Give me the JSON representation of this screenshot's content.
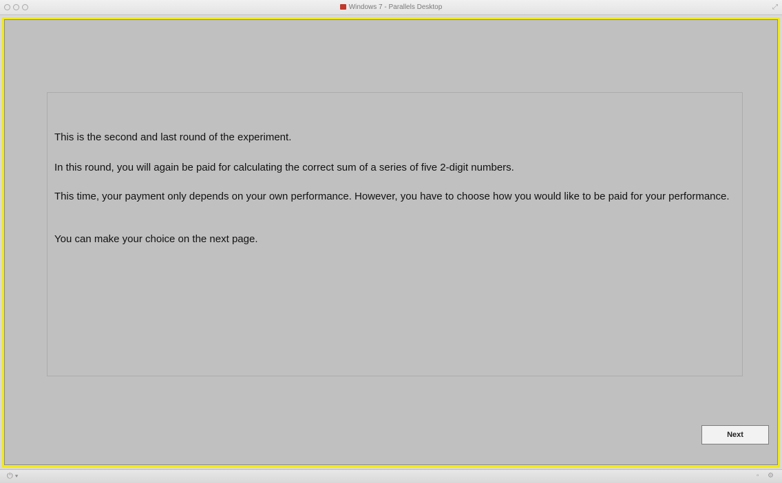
{
  "window": {
    "title": "Windows 7 - Parallels Desktop",
    "app_icon": "parallels-icon",
    "controls": [
      "close-button",
      "minimize-button",
      "zoom-button"
    ]
  },
  "screen": {
    "border_color": "#f2ea19",
    "background_color": "#c0c0c0",
    "paragraphs": [
      "This is the second and last round of the experiment.",
      "In this round, you will again be paid for calculating the correct sum of a series of five 2-digit numbers.",
      "This time, your payment only depends on your own performance. However, you have to choose how you would like to be paid for your performance.",
      "You can make your choice on the next page."
    ],
    "next_label": "Next"
  },
  "statusbar": {
    "left_icon": "power-icon",
    "right_icons": [
      "keyboard-icon",
      "settings-icon"
    ]
  }
}
